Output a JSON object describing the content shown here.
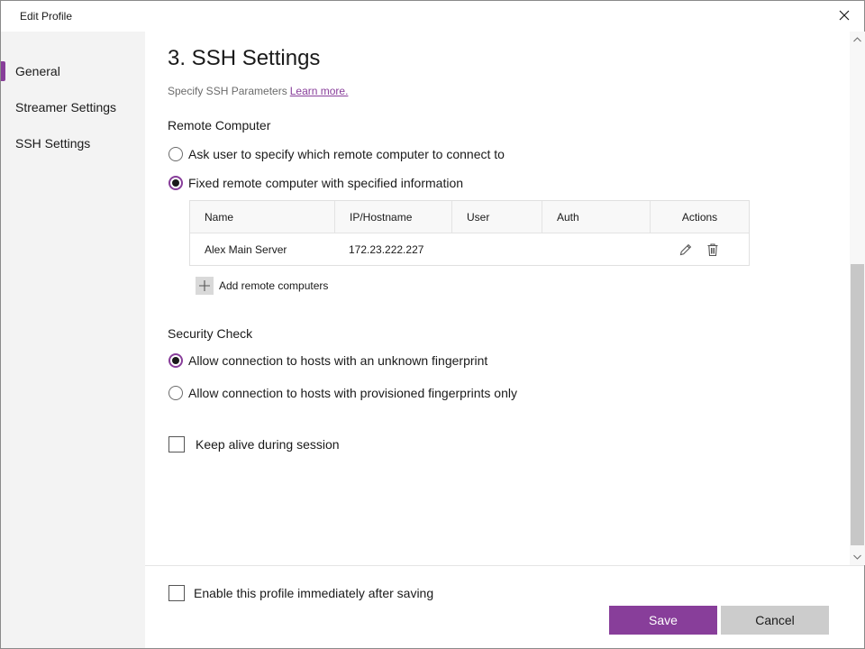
{
  "window": {
    "title": "Edit Profile"
  },
  "sidebar": {
    "items": [
      {
        "label": "General",
        "active": true
      },
      {
        "label": "Streamer Settings",
        "active": false
      },
      {
        "label": "SSH Settings",
        "active": false
      }
    ]
  },
  "main": {
    "heading": "3. SSH Settings",
    "subtitle": "Specify SSH Parameters",
    "learn_more": "Learn more.",
    "remote_computer": {
      "label": "Remote Computer",
      "options": [
        {
          "label": "Ask user to specify which remote computer to connect to",
          "selected": false
        },
        {
          "label": "Fixed remote computer with specified information",
          "selected": true
        }
      ]
    },
    "table": {
      "columns": [
        "Name",
        "IP/Hostname",
        "User",
        "Auth",
        "Actions"
      ],
      "rows": [
        {
          "name": "Alex Main Server",
          "ip": "172.23.222.227",
          "user": "",
          "auth": ""
        }
      ]
    },
    "add_remote_label": "Add remote computers",
    "security_check": {
      "label": "Security Check",
      "options": [
        {
          "label": "Allow connection to hosts with an unknown fingerprint",
          "selected": true
        },
        {
          "label": "Allow connection to hosts with provisioned fingerprints only",
          "selected": false
        }
      ]
    },
    "keep_alive": {
      "label": "Keep alive during session",
      "checked": false
    }
  },
  "footer": {
    "enable_profile": {
      "label": "Enable this profile immediately after saving",
      "checked": false
    },
    "save_label": "Save",
    "cancel_label": "Cancel"
  },
  "colors": {
    "accent": "#883e9a",
    "sidebar_bg": "#f3f3f3",
    "cancel_bg": "#cccccc"
  },
  "icons": [
    "close-icon",
    "edit-icon",
    "trash-icon",
    "plus-icon",
    "chevron-up-icon",
    "chevron-down-icon"
  ]
}
